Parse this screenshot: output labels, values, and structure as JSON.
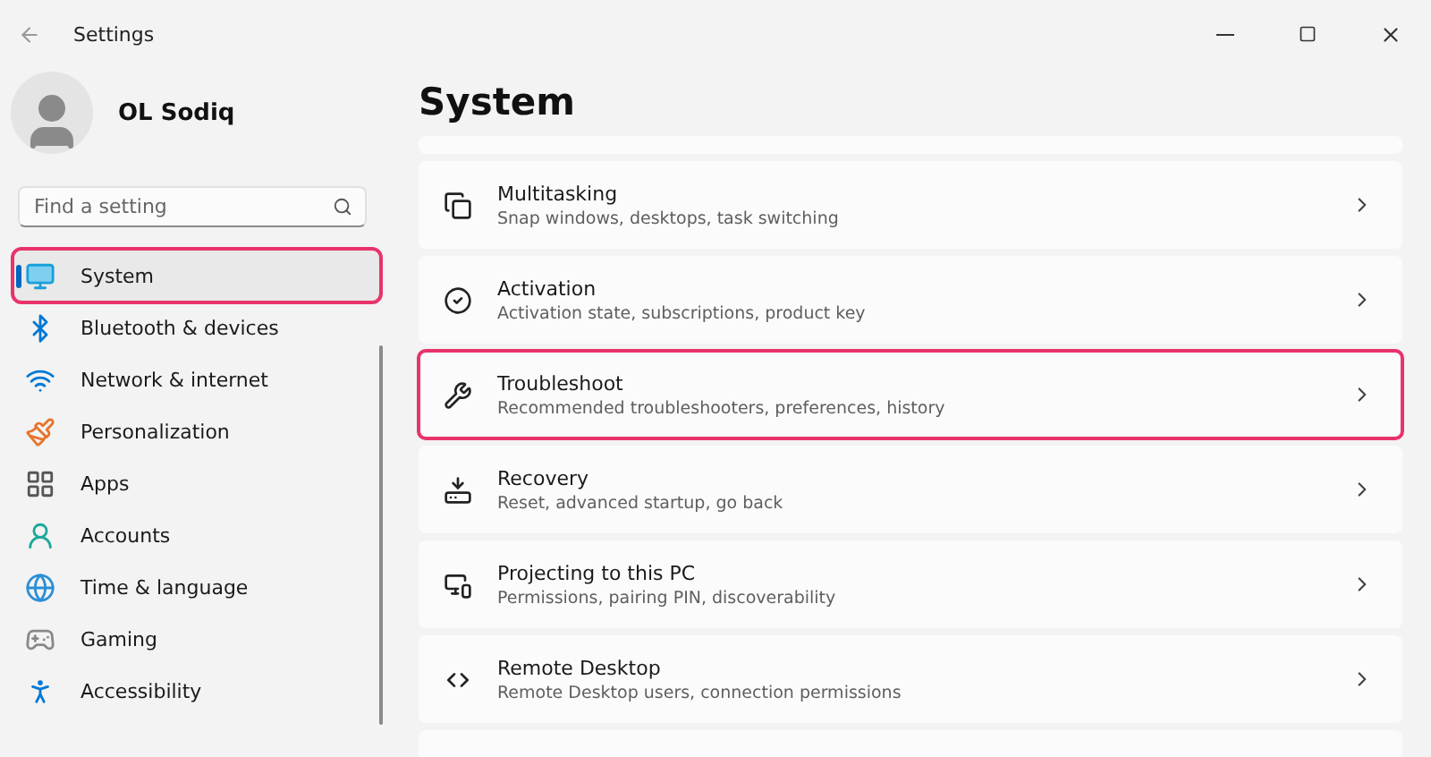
{
  "window": {
    "title": "Settings"
  },
  "profile": {
    "name": "OL Sodiq"
  },
  "search": {
    "placeholder": "Find a setting"
  },
  "nav": [
    {
      "label": "System",
      "selected": true,
      "highlighted": true
    },
    {
      "label": "Bluetooth & devices",
      "selected": false,
      "highlighted": false
    },
    {
      "label": "Network & internet",
      "selected": false,
      "highlighted": false
    },
    {
      "label": "Personalization",
      "selected": false,
      "highlighted": false
    },
    {
      "label": "Apps",
      "selected": false,
      "highlighted": false
    },
    {
      "label": "Accounts",
      "selected": false,
      "highlighted": false
    },
    {
      "label": "Time & language",
      "selected": false,
      "highlighted": false
    },
    {
      "label": "Gaming",
      "selected": false,
      "highlighted": false
    },
    {
      "label": "Accessibility",
      "selected": false,
      "highlighted": false
    }
  ],
  "page": {
    "title": "System"
  },
  "cards": [
    {
      "title": "Multitasking",
      "subtitle": "Snap windows, desktops, task switching",
      "highlighted": false
    },
    {
      "title": "Activation",
      "subtitle": "Activation state, subscriptions, product key",
      "highlighted": false
    },
    {
      "title": "Troubleshoot",
      "subtitle": "Recommended troubleshooters, preferences, history",
      "highlighted": true
    },
    {
      "title": "Recovery",
      "subtitle": "Reset, advanced startup, go back",
      "highlighted": false
    },
    {
      "title": "Projecting to this PC",
      "subtitle": "Permissions, pairing PIN, discoverability",
      "highlighted": false
    },
    {
      "title": "Remote Desktop",
      "subtitle": "Remote Desktop users, connection permissions",
      "highlighted": false
    }
  ]
}
